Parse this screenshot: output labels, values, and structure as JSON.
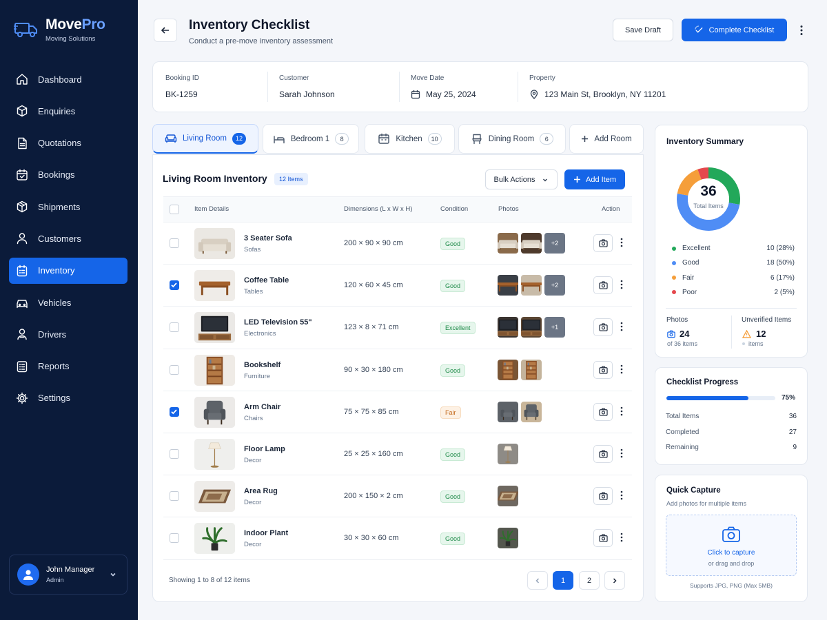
{
  "brand": {
    "name_a": "Move",
    "name_b": "Pro",
    "tagline": "Moving Solutions"
  },
  "nav": [
    {
      "label": "Dashboard",
      "icon": "home-icon"
    },
    {
      "label": "Enquiries",
      "icon": "cube-icon"
    },
    {
      "label": "Quotations",
      "icon": "document-icon"
    },
    {
      "label": "Bookings",
      "icon": "calendar-check-icon"
    },
    {
      "label": "Shipments",
      "icon": "package-icon"
    },
    {
      "label": "Customers",
      "icon": "user-icon"
    },
    {
      "label": "Inventory",
      "icon": "clipboard-list-icon",
      "active": true
    },
    {
      "label": "Vehicles",
      "icon": "car-icon"
    },
    {
      "label": "Drivers",
      "icon": "driver-icon"
    },
    {
      "label": "Reports",
      "icon": "report-icon"
    },
    {
      "label": "Settings",
      "icon": "gear-icon"
    }
  ],
  "user": {
    "name": "John Manager",
    "role": "Admin"
  },
  "header": {
    "title": "Inventory Checklist",
    "subtitle": "Conduct a pre-move inventory assessment",
    "save_draft": "Save Draft",
    "complete": "Complete Checklist"
  },
  "booking": {
    "id_label": "Booking ID",
    "id": "BK-1259",
    "customer_label": "Customer",
    "customer": "Sarah Johnson",
    "date_label": "Move Date",
    "date": "May 25, 2024",
    "property_label": "Property",
    "property": "123 Main St, Brooklyn, NY 11201"
  },
  "tabs": [
    {
      "label": "Living Room",
      "count": "12",
      "icon": "sofa-icon",
      "active": true
    },
    {
      "label": "Bedroom 1",
      "count": "8",
      "icon": "bed-icon"
    },
    {
      "label": "Kitchen",
      "count": "10",
      "icon": "kitchen-icon"
    },
    {
      "label": "Dining Room",
      "count": "6",
      "icon": "chair-icon"
    }
  ],
  "add_room": "Add Room",
  "inventory": {
    "title": "Living Room Inventory",
    "badge": "12 Items",
    "bulk": "Bulk Actions",
    "add_item": "Add Item",
    "columns": {
      "details": "Item Details",
      "dims": "Dimensions (L x W x H)",
      "condition": "Condition",
      "photos": "Photos",
      "action": "Action"
    },
    "items": [
      {
        "name": "3 Seater Sofa",
        "category": "Sofas",
        "dims": "200 × 90 × 90 cm",
        "condition": "Good",
        "photos": 2,
        "more": "+2",
        "checked": false,
        "kind": "sofa"
      },
      {
        "name": "Coffee Table",
        "category": "Tables",
        "dims": "120 × 60 × 45 cm",
        "condition": "Good",
        "photos": 2,
        "more": "+2",
        "checked": true,
        "kind": "table"
      },
      {
        "name": "LED Television 55\"",
        "category": "Electronics",
        "dims": "123 × 8 × 71 cm",
        "condition": "Excellent",
        "photos": 2,
        "more": "+1",
        "checked": false,
        "kind": "tv"
      },
      {
        "name": "Bookshelf",
        "category": "Furniture",
        "dims": "90 × 30 × 180 cm",
        "condition": "Good",
        "photos": 2,
        "more": "",
        "checked": false,
        "kind": "shelf"
      },
      {
        "name": "Arm Chair",
        "category": "Chairs",
        "dims": "75 × 75 × 85 cm",
        "condition": "Fair",
        "photos": 2,
        "more": "",
        "checked": true,
        "kind": "chair"
      },
      {
        "name": "Floor Lamp",
        "category": "Decor",
        "dims": "25 × 25 × 160 cm",
        "condition": "Good",
        "photos": 1,
        "more": "",
        "checked": false,
        "kind": "lamp"
      },
      {
        "name": "Area Rug",
        "category": "Decor",
        "dims": "200 × 150 × 2 cm",
        "condition": "Good",
        "photos": 1,
        "more": "",
        "checked": false,
        "kind": "rug"
      },
      {
        "name": "Indoor Plant",
        "category": "Decor",
        "dims": "30 × 30 × 60 cm",
        "condition": "Good",
        "photos": 1,
        "more": "",
        "checked": false,
        "kind": "plant"
      }
    ],
    "showing": "Showing 1 to 8 of 12 items",
    "pages": [
      "1",
      "2"
    ]
  },
  "summary": {
    "title": "Inventory Summary",
    "total": "36",
    "total_label": "Total Items",
    "legend": [
      {
        "label": "Excellent",
        "value": "10 (28%)",
        "count": 10,
        "color": "#22a85a"
      },
      {
        "label": "Good",
        "value": "18 (50%)",
        "count": 18,
        "color": "#4f8df5"
      },
      {
        "label": "Fair",
        "value": "6 (17%)",
        "count": 6,
        "color": "#f59e3a"
      },
      {
        "label": "Poor",
        "value": "2 (5%)",
        "count": 2,
        "color": "#e5484d"
      }
    ],
    "photos_label": "Photos",
    "photos_value": "24",
    "photos_sub": "of 36 items",
    "unverified_label": "Unverified Items",
    "unverified_value": "12",
    "unverified_sub": "items"
  },
  "progress": {
    "title": "Checklist Progress",
    "percent": 75,
    "percent_label": "75%",
    "rows": [
      {
        "label": "Total Items",
        "value": "36"
      },
      {
        "label": "Completed",
        "value": "27"
      },
      {
        "label": "Remaining",
        "value": "9"
      }
    ]
  },
  "capture": {
    "title": "Quick Capture",
    "subtitle": "Add photos for multiple items",
    "cta": "Click to capture",
    "hint": "or drag and drop",
    "formats": "Supports JPG, PNG (Max 5MB)"
  },
  "colors": {
    "primary": "#1565e8",
    "sidebar": "#0b1b3a"
  }
}
